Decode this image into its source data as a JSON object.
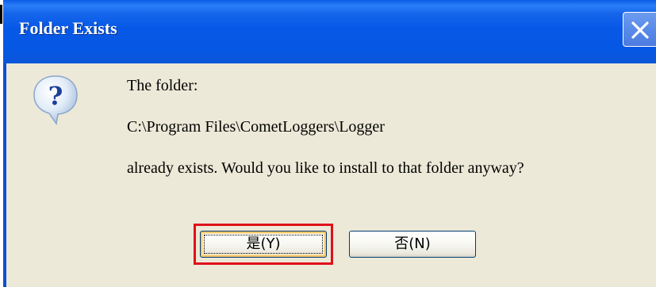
{
  "dialog": {
    "title": "Folder Exists",
    "icon": "question-icon",
    "close_icon": "close-icon",
    "message": {
      "line1": "The folder:",
      "path": "C:\\Program Files\\CometLoggers\\Logger",
      "line3": "already exists. Would you like to install to that folder anyway?"
    },
    "buttons": {
      "yes_label": "是(Y)",
      "no_label": "否(N)"
    }
  },
  "colors": {
    "titlebar": "#0758e6",
    "client_background": "#ece9d8",
    "highlight": "#e0101a"
  }
}
